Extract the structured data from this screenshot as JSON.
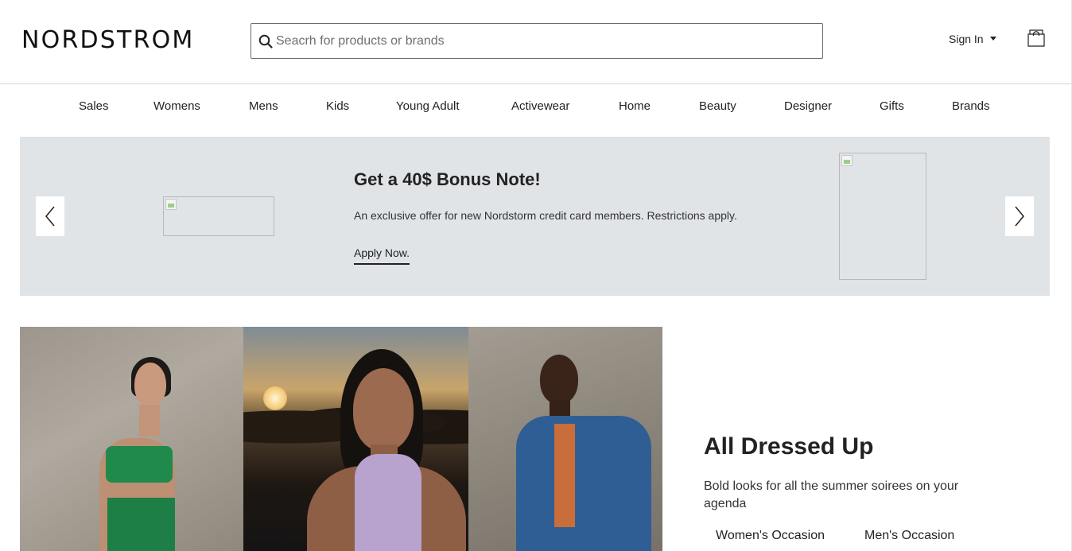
{
  "header": {
    "logo": "NORDSTROM",
    "search_placeholder": "Seacrh for products or brands",
    "signin_label": "Sign In"
  },
  "nav": {
    "items": [
      "Sales",
      "Womens",
      "Mens",
      "Kids",
      "Young Adult",
      "Activewear",
      "Home",
      "Beauty",
      "Designer",
      "Gifts",
      "Brands"
    ]
  },
  "promo": {
    "title": "Get a 40$ Bonus Note!",
    "subtitle": "An exclusive offer for new Nordstorm credit card members. Restrictions apply.",
    "link": "Apply Now."
  },
  "feature": {
    "title": "All Dressed Up",
    "subtitle": "Bold looks for all the summer soirees on your agenda",
    "links": [
      "Women's Occasion",
      "Men's Occasion"
    ]
  },
  "colors": {
    "promo_bg": "#e1e4e7",
    "text": "#222222"
  }
}
